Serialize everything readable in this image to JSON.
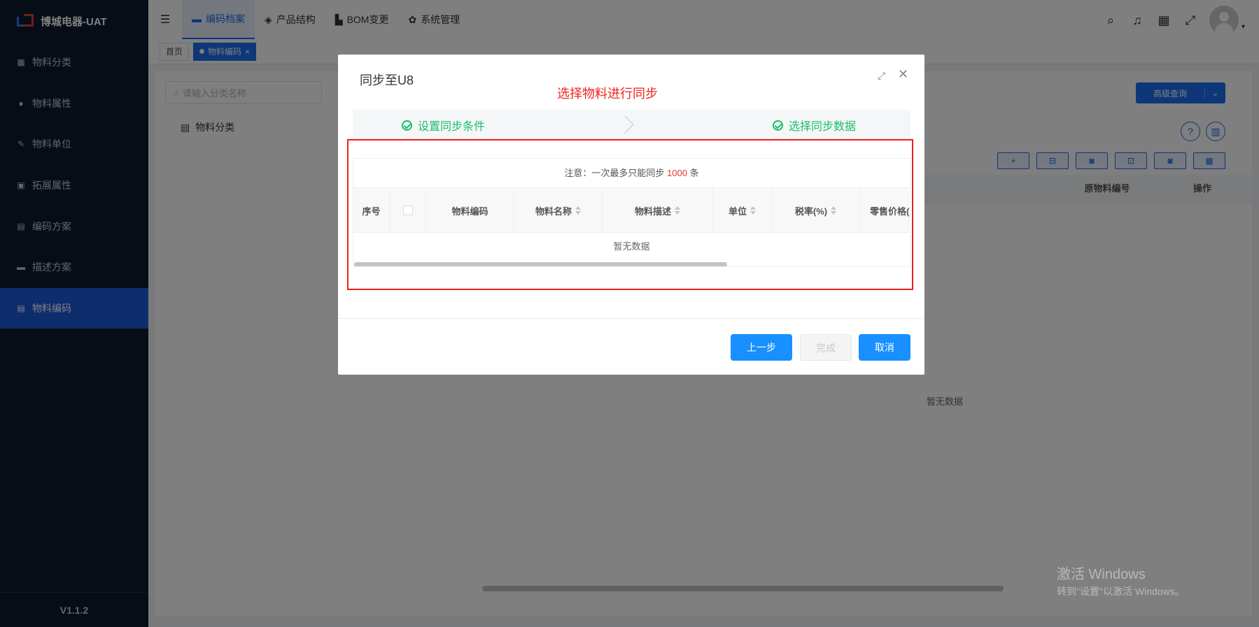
{
  "app": {
    "title": "博城电器-UAT",
    "version": "V1.1.2"
  },
  "sidebar": {
    "items": [
      {
        "label": "物料分类",
        "icon": "grid-icon"
      },
      {
        "label": "物料属性",
        "icon": "info-icon"
      },
      {
        "label": "物料单位",
        "icon": "pen-icon"
      },
      {
        "label": "拓展属性",
        "icon": "box-icon"
      },
      {
        "label": "编码方案",
        "icon": "doc-icon"
      },
      {
        "label": "描述方案",
        "icon": "card-icon"
      },
      {
        "label": "物料编码",
        "icon": "doc-icon",
        "active": true
      }
    ]
  },
  "topnav": {
    "items": [
      {
        "label": "编码档案",
        "active": true
      },
      {
        "label": "产品结构"
      },
      {
        "label": "BOM变更"
      },
      {
        "label": "系统管理"
      }
    ]
  },
  "tabs": {
    "home": "首页",
    "current": "物料编码",
    "close": "×"
  },
  "tree": {
    "search_placeholder": "请输入分类名称",
    "root": "物料分类"
  },
  "content": {
    "adv_query": "高级查询",
    "columns": {
      "orig_code": "原物料编号",
      "ops": "操作"
    },
    "empty": "暂无数据"
  },
  "dialog": {
    "title": "同步至U8",
    "annotation": "选择物料进行同步",
    "steps": [
      "设置同步条件",
      "选择同步数据"
    ],
    "notice_prefix": "注意：一次最多只能同步",
    "notice_num": "1000",
    "notice_suffix": "条",
    "columns": [
      "序号",
      "物料编码",
      "物料名称",
      "物料描述",
      "单位",
      "税率(%)",
      "零售价格("
    ],
    "empty": "暂无数据",
    "buttons": {
      "prev": "上一步",
      "done": "完成",
      "cancel": "取消"
    }
  },
  "watermark": {
    "line1": "激活 Windows",
    "line2": "转到\"设置\"以激活 Windows。"
  },
  "colors": {
    "sidebar_bg": "#0e1a2c",
    "primary": "#1b6ef3",
    "success": "#19be6b",
    "annotation": "#f01f1f"
  }
}
